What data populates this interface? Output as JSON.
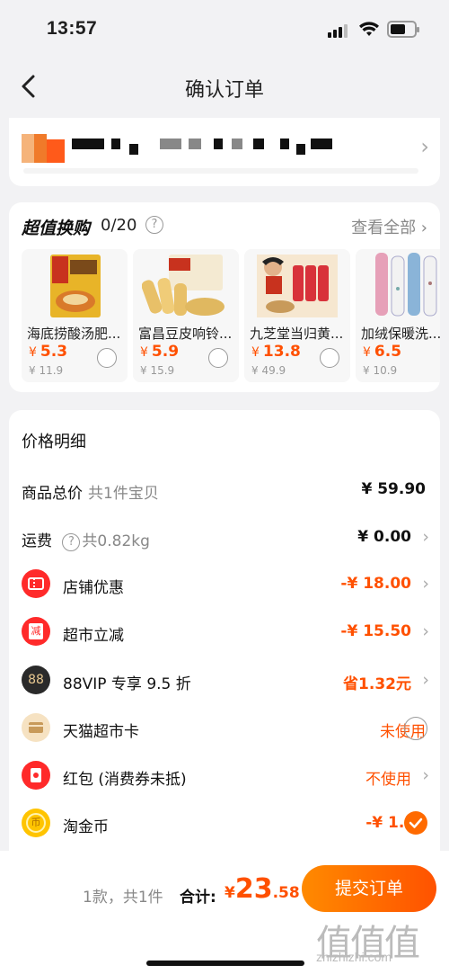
{
  "status": {
    "time": "13:57"
  },
  "header": {
    "title": "确认订单",
    "back_icon": "chevron-left-icon"
  },
  "address": {
    "arrow": "›"
  },
  "swap": {
    "title": "超值换购",
    "count": "0/20",
    "help": "?",
    "view_all": "查看全部 ›",
    "items": [
      {
        "name": "海底捞酸汤肥...",
        "currency": "¥",
        "price": "5.3",
        "old_price": "¥ 11.9"
      },
      {
        "name": "富昌豆皮响铃...",
        "currency": "¥",
        "price": "5.9",
        "old_price": "¥ 15.9"
      },
      {
        "name": "九芝堂当归黄...",
        "currency": "¥",
        "price": "13.8",
        "old_price": "¥ 49.9"
      },
      {
        "name": "加绒保暖洗...",
        "currency": "¥",
        "price": "6.5",
        "old_price": "¥ 10.9"
      }
    ]
  },
  "price_detail": {
    "title": "价格明细",
    "total_goods": {
      "label": "商品总价",
      "sub": "共1件宝贝",
      "value": "¥ 59.90"
    },
    "shipping": {
      "label": "运费",
      "sub": "共0.82kg",
      "value": "¥ 0.00"
    },
    "store_discount": {
      "label": "店铺优惠",
      "value": "-¥ 18.00"
    },
    "market_discount": {
      "label": "超市立减",
      "value": "-¥ 15.50",
      "icon_char": "减"
    },
    "vip": {
      "label": "88VIP 专享 9.5 折",
      "value": "省1.32元",
      "icon_char": "88"
    },
    "card": {
      "label": "天猫超市卡",
      "value": "未使用"
    },
    "redpacket": {
      "label": "红包 (消费券未抵)",
      "value": "不使用"
    },
    "coin": {
      "label": "淘金币",
      "value": "-¥ 1.50",
      "icon_char": "币"
    }
  },
  "footer": {
    "count": "1款，共1件",
    "total_label": "合计:",
    "currency": "¥",
    "amount_int": "23",
    "amount_dec": ".58",
    "submit": "提交订单"
  },
  "watermark": {
    "chars": "值值值",
    "url": "zhizhizhi.com"
  },
  "colors": {
    "accent": "#ff5000",
    "button_start": "#ff8a00",
    "button_end": "#ff5200"
  }
}
